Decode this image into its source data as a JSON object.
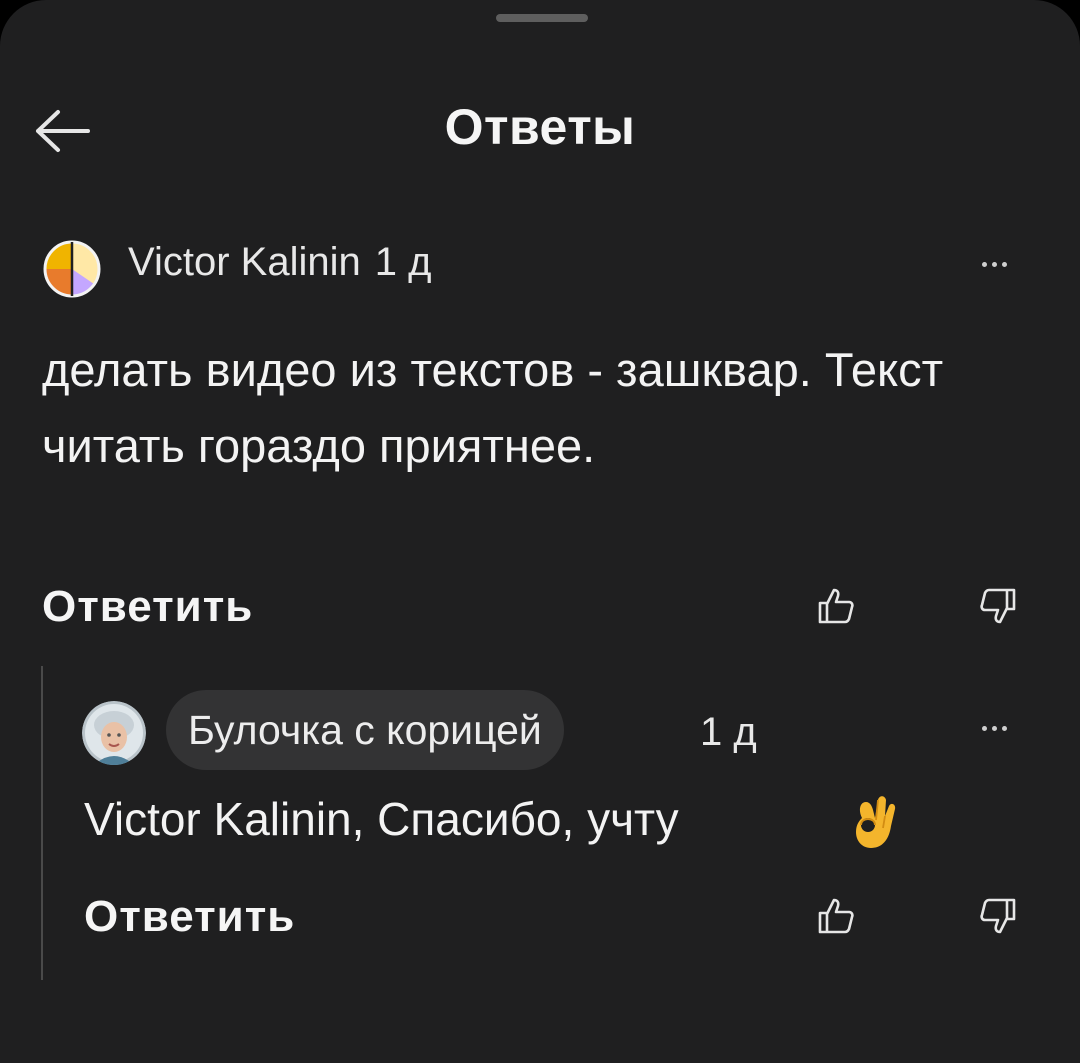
{
  "header": {
    "title": "Ответы",
    "back_icon": "arrow-left-icon"
  },
  "comment": {
    "author": "Victor Kalinin",
    "time": "1 д",
    "text": "делать видео из текстов - зашквар. Текст читать гораздо приятнее.",
    "reply_label": "Ответить",
    "icons": [
      "more-icon",
      "thumbs-up-icon",
      "thumbs-down-icon"
    ]
  },
  "reply": {
    "author": "Булочка с корицей",
    "time": "1 д",
    "text": "Victor Kalinin, Спасибо, учту",
    "emoji": "ok-hand-emoji",
    "reply_label": "Ответить",
    "icons": [
      "more-icon",
      "thumbs-up-icon",
      "thumbs-down-icon"
    ]
  },
  "colors": {
    "background": "#1f1f20",
    "text": "#f3f3f3",
    "chip": "#333334",
    "thread_line": "#4a4a4a"
  }
}
